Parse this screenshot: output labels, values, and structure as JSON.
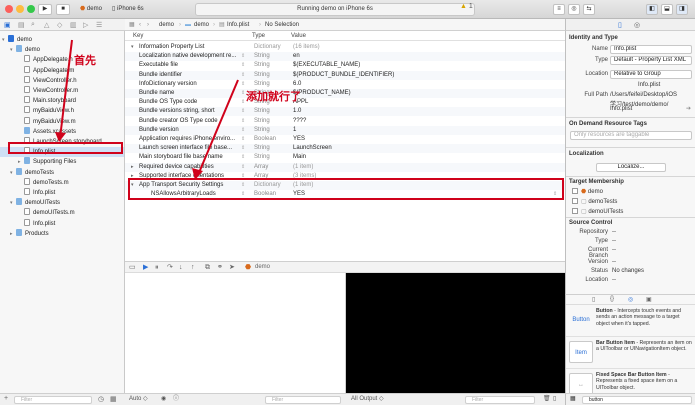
{
  "toolbar": {
    "scheme_target": "demo",
    "scheme_device": "iPhone 6s",
    "activity_text": "Running demo on iPhone 6s",
    "warning_count": "1"
  },
  "navigator": {
    "items": [
      {
        "label": "demo",
        "kind": "project",
        "level": 0,
        "disclosure": "▾"
      },
      {
        "label": "demo",
        "kind": "folder",
        "level": 1,
        "disclosure": "▾"
      },
      {
        "label": "AppDelegate.h",
        "kind": "h",
        "level": 2,
        "disclosure": ""
      },
      {
        "label": "AppDelegate.m",
        "kind": "m",
        "level": 2,
        "disclosure": ""
      },
      {
        "label": "ViewController.h",
        "kind": "h",
        "level": 2,
        "disclosure": ""
      },
      {
        "label": "ViewController.m",
        "kind": "m",
        "level": 2,
        "disclosure": ""
      },
      {
        "label": "Main.storyboard",
        "kind": "s",
        "level": 2,
        "disclosure": ""
      },
      {
        "label": "myBaiduView.h",
        "kind": "h",
        "level": 2,
        "disclosure": ""
      },
      {
        "label": "myBaiduView.m",
        "kind": "m",
        "level": 2,
        "disclosure": ""
      },
      {
        "label": "Assets.xcassets",
        "kind": "folder",
        "level": 2,
        "disclosure": ""
      },
      {
        "label": "LaunchScreen.storyboard",
        "kind": "s",
        "level": 2,
        "disclosure": ""
      },
      {
        "label": "Info.plist",
        "kind": "plist",
        "level": 2,
        "disclosure": "",
        "selected": true
      },
      {
        "label": "Supporting Files",
        "kind": "folder",
        "level": 2,
        "disclosure": "▸"
      },
      {
        "label": "demoTests",
        "kind": "folder",
        "level": 1,
        "disclosure": "▾"
      },
      {
        "label": "demoTests.m",
        "kind": "m",
        "level": 2,
        "disclosure": ""
      },
      {
        "label": "Info.plist",
        "kind": "plist",
        "level": 2,
        "disclosure": ""
      },
      {
        "label": "demoUITests",
        "kind": "folder",
        "level": 1,
        "disclosure": "▾"
      },
      {
        "label": "demoUITests.m",
        "kind": "m",
        "level": 2,
        "disclosure": ""
      },
      {
        "label": "Info.plist",
        "kind": "plist",
        "level": 2,
        "disclosure": ""
      },
      {
        "label": "Products",
        "kind": "folder",
        "level": 1,
        "disclosure": "▸"
      }
    ]
  },
  "jumpbar": {
    "crumbs": [
      "demo",
      "demo",
      "Info.plist",
      "No Selection"
    ]
  },
  "plist": {
    "headers": {
      "key": "Key",
      "type": "Type",
      "value": "Value"
    },
    "rows": [
      {
        "key": "Information Property List",
        "type": "Dictionary",
        "value": "(16 items)",
        "disc": "▾",
        "muted_type": true,
        "muted_value": true
      },
      {
        "key": "Localization native development re...",
        "type": "String",
        "value": "en"
      },
      {
        "key": "Executable file",
        "type": "String",
        "value": "$(EXECUTABLE_NAME)"
      },
      {
        "key": "Bundle identifier",
        "type": "String",
        "value": "$(PRODUCT_BUNDLE_IDENTIFIER)"
      },
      {
        "key": "InfoDictionary version",
        "type": "String",
        "value": "6.0"
      },
      {
        "key": "Bundle name",
        "type": "String",
        "value": "$(PRODUCT_NAME)"
      },
      {
        "key": "Bundle OS Type code",
        "type": "String",
        "value": "APPL"
      },
      {
        "key": "Bundle versions string, short",
        "type": "String",
        "value": "1.0"
      },
      {
        "key": "Bundle creator OS Type code",
        "type": "String",
        "value": "????"
      },
      {
        "key": "Bundle version",
        "type": "String",
        "value": "1"
      },
      {
        "key": "Application requires iPhone enviro...",
        "type": "Boolean",
        "value": "YES"
      },
      {
        "key": "Launch screen interface file base...",
        "type": "String",
        "value": "LaunchScreen"
      },
      {
        "key": "Main storyboard file base name",
        "type": "String",
        "value": "Main"
      },
      {
        "key": "Required device capabilities",
        "type": "Array",
        "value": "(1 item)",
        "disc": "▸",
        "muted_value": true
      },
      {
        "key": "Supported interface orientations",
        "type": "Array",
        "value": "(3 items)",
        "disc": "▸",
        "muted_value": true
      },
      {
        "key": "App Transport Security Settings",
        "type": "Dictionary",
        "value": "(1 item)",
        "disc": "▾",
        "muted_type": true,
        "muted_value": true
      },
      {
        "key": "NSAllowsArbitraryLoads",
        "type": "Boolean",
        "value": "YES",
        "indent": true
      }
    ]
  },
  "annotations": {
    "first": "首先",
    "add_here": "添加就行了"
  },
  "debug": {
    "target": "demo",
    "auto_label": "Auto ◇",
    "filter_placeholder": "Filter",
    "output_label": "All Output ◇",
    "filter_placeholder2": "Filter"
  },
  "inspector": {
    "identity_title": "Identity and Type",
    "name_label": "Name",
    "name_value": "Info.plist",
    "type_label": "Type",
    "type_value": "Default - Property List XML",
    "location_label": "Location",
    "location_value": "Relative to Group",
    "location_file": "Info.plist",
    "fullpath_label": "Full Path",
    "fullpath_lines": [
      "/Users/feifei/Desktop/iOS",
      "学习/test/demo/demo/",
      "Info.plist"
    ],
    "ondemand_title": "On Demand Resource Tags",
    "tags_placeholder": "Only resources are taggable",
    "localization_title": "Localization",
    "localize_button": "Localize...",
    "membership_title": "Target Membership",
    "targets": [
      {
        "label": "demo",
        "checked": false
      },
      {
        "label": "demoTests",
        "checked": false
      },
      {
        "label": "demoUITests",
        "checked": false
      }
    ],
    "source_title": "Source Control",
    "repo_label": "Repository",
    "repo_value": "--",
    "sctype_label": "Type",
    "sctype_value": "--",
    "branch_label": "Current Branch",
    "branch_value": "--",
    "version_label": "Version",
    "version_value": "--",
    "status_label": "Status",
    "status_value": "No changes",
    "location2_label": "Location",
    "location2_value": "--"
  },
  "library": {
    "items": [
      {
        "icon": "Button",
        "name": "Button",
        "desc": " - Intercepts touch events and sends an action message to a target object when it's tapped."
      },
      {
        "icon": "Item",
        "name": "Bar Button Item",
        "desc": " - Represents an item on a UIToolbar or UINavigationItem object."
      },
      {
        "icon": "",
        "name": "Fixed Space Bar Button Item",
        "desc": " - Represents a fixed space item on a UIToolbar object."
      }
    ],
    "search_value": "button"
  },
  "colors": {
    "accent": "#2a6fd6",
    "annotation": "#d0021b",
    "selection": "#cfe0f5"
  }
}
